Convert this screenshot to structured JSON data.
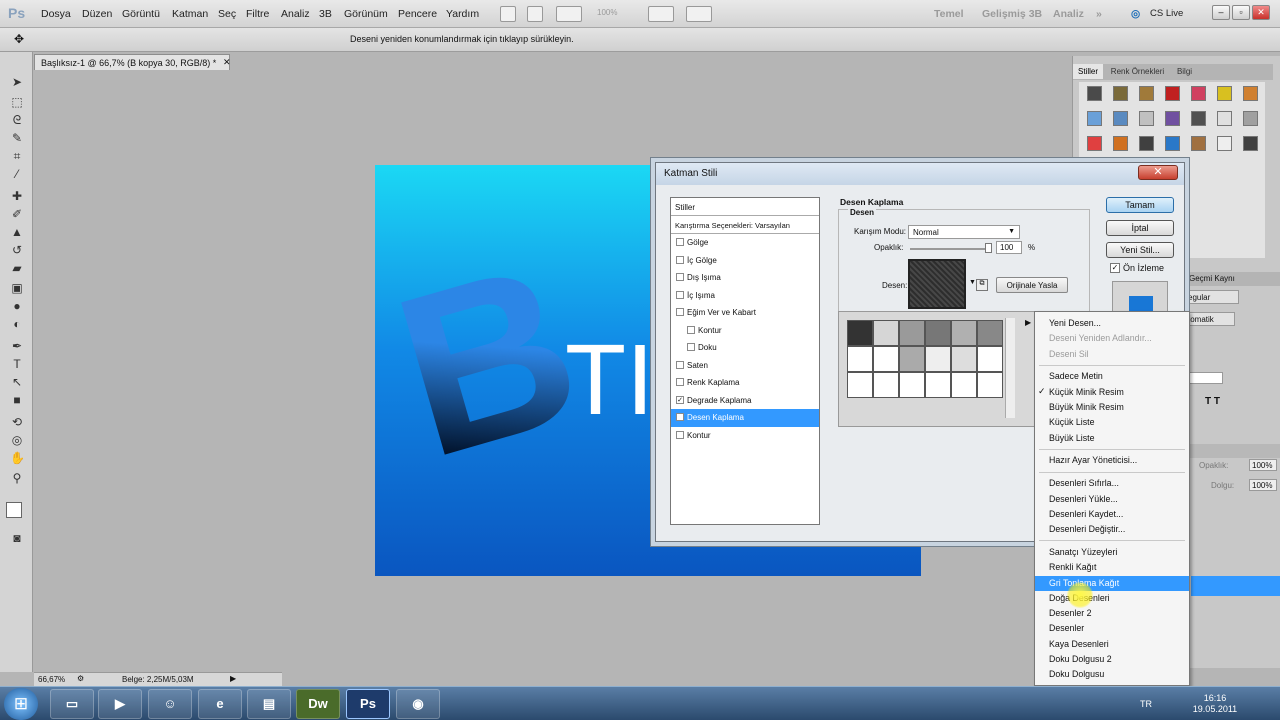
{
  "menubar": {
    "app_logo": "Ps",
    "items": [
      "Dosya",
      "Düzen",
      "Görüntü",
      "Katman",
      "Seç",
      "Filtre",
      "Analiz",
      "3B",
      "Görünüm",
      "Pencere",
      "Yardım"
    ],
    "zoom": "100%",
    "workspaces": [
      "Temel",
      "Gelişmiş 3B",
      "Analiz"
    ],
    "cs_live": "CS Live"
  },
  "options": {
    "hint": "Deseni yeniden konumlandırmak için tıklayıp sürükleyin."
  },
  "doc_tab": {
    "title": "Başlıksız-1 @ 66,7% (B kopya 30, RGB/8) *"
  },
  "canvas": {
    "big_letter": "B",
    "text": "TI"
  },
  "status": {
    "zoom": "66,67%",
    "doc_info": "Belge: 2,25M/5,03M"
  },
  "right_panel": {
    "tabs": [
      "Stiller",
      "Renk Örnekleri",
      "Bilgi"
    ],
    "fragments": [
      "Geçmi",
      "Kaynı",
      "egular",
      "tomatik",
      "Opaklık:",
      "100%",
      "Dolgu:",
      "100%"
    ]
  },
  "dialog": {
    "title": "Katman Stili",
    "styles_header": "Stiller",
    "blend_options": "Karıştırma Seçenekleri: Varsayılan",
    "style_items": [
      {
        "label": "Gölge",
        "checked": false,
        "indent": false
      },
      {
        "label": "İç Gölge",
        "checked": false,
        "indent": false
      },
      {
        "label": "Dış Işıma",
        "checked": false,
        "indent": false
      },
      {
        "label": "İç Işıma",
        "checked": false,
        "indent": false
      },
      {
        "label": "Eğim Ver ve Kabart",
        "checked": false,
        "indent": false
      },
      {
        "label": "Kontur",
        "checked": false,
        "indent": true
      },
      {
        "label": "Doku",
        "checked": false,
        "indent": true
      },
      {
        "label": "Saten",
        "checked": false,
        "indent": false
      },
      {
        "label": "Renk Kaplama",
        "checked": false,
        "indent": false
      },
      {
        "label": "Degrade Kaplama",
        "checked": true,
        "indent": false
      },
      {
        "label": "Desen Kaplama",
        "checked": true,
        "indent": false,
        "selected": true
      },
      {
        "label": "Kontur",
        "checked": false,
        "indent": false
      }
    ],
    "section_title": "Desen Kaplama",
    "group_title": "Desen",
    "blend_mode_label": "Karışım Modu:",
    "blend_mode_value": "Normal",
    "opacity_label": "Opaklık:",
    "opacity_value": "100",
    "opacity_unit": "%",
    "pattern_label": "Desen:",
    "snap_origin": "Orijinale Yasla",
    "buttons": {
      "ok": "Tamam",
      "cancel": "İptal",
      "new_style": "Yeni Stil..."
    },
    "preview_label": "Ön İzleme",
    "preview_checked": true
  },
  "context_menu": {
    "items": [
      {
        "label": "Yeni Desen...",
        "state": "normal"
      },
      {
        "label": "Deseni Yeniden Adlandır...",
        "state": "disabled"
      },
      {
        "label": "Deseni Sil",
        "state": "disabled"
      },
      {
        "label": "Sadece Metin",
        "state": "normal"
      },
      {
        "label": "Küçük Minik Resim",
        "state": "checked"
      },
      {
        "label": "Büyük Minik Resim",
        "state": "normal"
      },
      {
        "label": "Küçük Liste",
        "state": "normal"
      },
      {
        "label": "Büyük Liste",
        "state": "normal"
      },
      {
        "label": "Hazır Ayar Yöneticisi...",
        "state": "normal"
      },
      {
        "label": "Desenleri Sıfırla...",
        "state": "normal"
      },
      {
        "label": "Desenleri Yükle...",
        "state": "normal"
      },
      {
        "label": "Desenleri Kaydet...",
        "state": "normal"
      },
      {
        "label": "Desenleri Değiştir...",
        "state": "normal"
      },
      {
        "label": "Sanatçı Yüzeyleri",
        "state": "normal"
      },
      {
        "label": "Renkli Kağıt",
        "state": "normal"
      },
      {
        "label": "Gri Tonlama Kağıt",
        "state": "highlighted"
      },
      {
        "label": "Doğa Desenleri",
        "state": "normal"
      },
      {
        "label": "Desenler 2",
        "state": "normal"
      },
      {
        "label": "Desenler",
        "state": "normal"
      },
      {
        "label": "Kaya Desenleri",
        "state": "normal"
      },
      {
        "label": "Doku Dolgusu 2",
        "state": "normal"
      },
      {
        "label": "Doku Dolgusu",
        "state": "normal"
      }
    ]
  },
  "taskbar": {
    "lang": "TR",
    "time": "16:16",
    "date": "19.05.2011",
    "apps": [
      "explorer-icon",
      "media-player-icon",
      "messenger-icon",
      "ie-icon",
      "notes-icon",
      "Dw",
      "Ps",
      "chrome-icon"
    ]
  },
  "colors": {
    "accent": "#3399ff",
    "canvas_top": "#1bd8f4",
    "canvas_bottom": "#0a56c0"
  }
}
